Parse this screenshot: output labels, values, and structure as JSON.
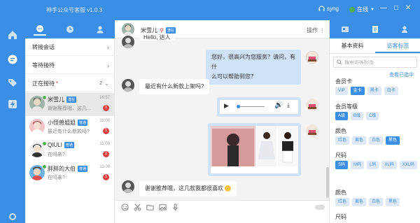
{
  "app": {
    "title": "神手公众号客服 v1.0.3",
    "brand_color": "#3b8ee6"
  },
  "titlebar": {
    "user": "syng",
    "status": "在线",
    "minimize": "—",
    "maximize": "□",
    "close": "✕"
  },
  "nav": {
    "icons": [
      "home-icon",
      "chat-icon",
      "tag-icon",
      "flash-icon",
      "settings-icon"
    ]
  },
  "sections": {
    "transfer": "转接会话",
    "waiting": "等待接待",
    "serving": "正在接待",
    "serving_star": "*",
    "serving_count": "2"
  },
  "conversations": [
    {
      "name": "米雪儿",
      "tag": "潜在",
      "message": "谢谢推荐哦，这几...",
      "time": "16:57",
      "unread": "1",
      "active": true
    },
    {
      "name": "小怪兽姐姐",
      "tag": "普通",
      "message": "最近有什么新款吗?",
      "time": "11:00",
      "unread": "1",
      "active": false
    },
    {
      "name": "QIULI",
      "tag": "普通",
      "message": "在吗亲?",
      "time": "11:00",
      "unread": "1",
      "active": false
    },
    {
      "name": "胖胖的大伯",
      "tag": "普通",
      "message": "在吗亲?",
      "time": "11:00",
      "unread": "1",
      "active": false
    }
  ],
  "chat": {
    "contact_name": "米雪儿",
    "contact_tag": "潜在",
    "operations": "操作",
    "messages": {
      "m0": "Hello, 达人",
      "m1_line1": "您好，很高兴为您服务？请问，有什",
      "m1_line2": "么可以帮助到您？",
      "m2": "最近有什么新款上架吗?",
      "m3": "谢谢推荐哦，这几款我都很喜欢"
    }
  },
  "right": {
    "tabs": [
      "基本资料",
      "访客标签"
    ],
    "search_placeholder": "搜索访客标签",
    "view_selected": "查看已选中",
    "groups": [
      {
        "title": "会员卡",
        "chips": [
          "VIP",
          "金卡",
          "黑卡",
          "白卡"
        ],
        "selected": [
          1
        ]
      },
      {
        "title": "会员等级",
        "chips": [
          "A级",
          "B级",
          "C级"
        ],
        "selected": [
          0
        ]
      },
      {
        "title": "颜色",
        "chips": [
          "红色",
          "黄色",
          "白色",
          "黑色"
        ],
        "selected": [
          3
        ]
      },
      {
        "title": "尺码",
        "chips": [
          "S码",
          "M码",
          "L码",
          "XL码",
          "XXL码"
        ],
        "selected": [
          0
        ]
      },
      {
        "title": "颜色",
        "chips": [
          "红色",
          "黄色",
          "白色",
          "黑色"
        ],
        "selected": []
      },
      {
        "title": "尺码",
        "chips": [],
        "selected": []
      }
    ]
  }
}
